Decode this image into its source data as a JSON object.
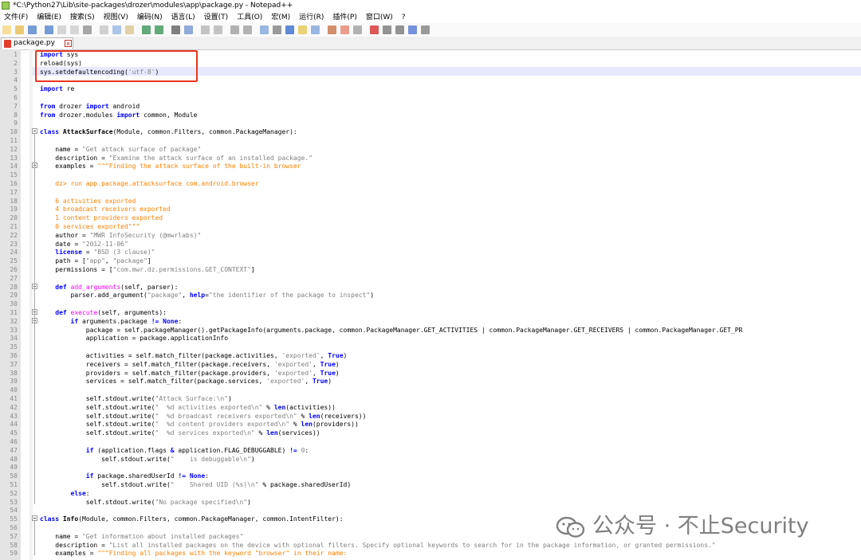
{
  "window": {
    "title": "*C:\\Python27\\Lib\\site-packages\\drozer\\modules\\app\\package.py - Notepad++"
  },
  "menu": [
    "文件(F)",
    "编辑(E)",
    "搜索(S)",
    "视图(V)",
    "编码(N)",
    "语言(L)",
    "设置(T)",
    "工具(O)",
    "宏(M)",
    "运行(R)",
    "插件(P)",
    "窗口(W)",
    "?"
  ],
  "toolbar_icons": [
    "new-icon",
    "open-icon",
    "save-icon",
    "save-all-icon",
    "close-icon",
    "close-all-icon",
    "print-icon",
    "cut-icon",
    "copy-icon",
    "paste-icon",
    "undo-icon",
    "redo-icon",
    "find-icon",
    "replace-icon",
    "zoom-in-icon",
    "zoom-out-icon",
    "sync-v-icon",
    "sync-h-icon",
    "wrap-icon",
    "all-chars-icon",
    "indent-guide-icon",
    "udl-icon",
    "doc-map-icon",
    "func-list-icon",
    "folder-workspace-icon",
    "monitor-icon",
    "record-icon",
    "stop-icon",
    "play-icon",
    "run-multiple-icon",
    "save-macro-icon"
  ],
  "tab": {
    "label": "package.py",
    "close": "x"
  },
  "watermark": {
    "text": "公众号 · 不止Security"
  },
  "colors": {
    "keyword": "#0000ff",
    "string": "#808080",
    "docstring": "#ff8000",
    "funcname": "#ff00ff",
    "highlight": "#e8e8ff",
    "annotation": "#e8361f"
  },
  "lines": [
    [
      [
        "import",
        "k"
      ],
      [
        " sys",
        "n"
      ]
    ],
    [
      [
        "reload(sys)",
        "n"
      ]
    ],
    [
      [
        "sys.setdefaultencoding(",
        "n"
      ],
      [
        "'utf-8'",
        "s"
      ],
      [
        ")",
        "n"
      ]
    ],
    [],
    [
      [
        "import",
        "k"
      ],
      [
        " re",
        "n"
      ]
    ],
    [],
    [
      [
        "from",
        "k"
      ],
      [
        " drozer ",
        "n"
      ],
      [
        "import",
        "k"
      ],
      [
        " android",
        "n"
      ]
    ],
    [
      [
        "from",
        "k"
      ],
      [
        " drozer.modules ",
        "n"
      ],
      [
        "import",
        "k"
      ],
      [
        " common, Module",
        "n"
      ]
    ],
    [],
    [
      [
        "class",
        "k"
      ],
      [
        " ",
        "n"
      ],
      [
        "AttackSurface",
        "c"
      ],
      [
        "(Module, common.Filters, common.PackageManager):",
        "n"
      ]
    ],
    [],
    [
      [
        "    name = ",
        "n"
      ],
      [
        "\"Get attack surface of package\"",
        "s"
      ]
    ],
    [
      [
        "    description = ",
        "n"
      ],
      [
        "\"Examine the attack surface of an installed package.\"",
        "s"
      ]
    ],
    [
      [
        "    examples = ",
        "n"
      ],
      [
        "\"\"\"Finding the attack surface of the built-in browser",
        "d"
      ]
    ],
    [],
    [
      [
        "    dz> run app.package.attacksurface com.android.browser",
        "d"
      ]
    ],
    [],
    [
      [
        "    6 activities exported",
        "d"
      ]
    ],
    [
      [
        "    4 broadcast receivers exported",
        "d"
      ]
    ],
    [
      [
        "    1 content providers exported",
        "d"
      ]
    ],
    [
      [
        "    0 services exported\"\"\"",
        "d"
      ]
    ],
    [
      [
        "    author = ",
        "n"
      ],
      [
        "\"MWR InfoSecurity (@mwrlabs)\"",
        "s"
      ]
    ],
    [
      [
        "    date = ",
        "n"
      ],
      [
        "\"2012-11-06\"",
        "s"
      ]
    ],
    [
      [
        "    ",
        "n"
      ],
      [
        "license",
        "k"
      ],
      [
        " = ",
        "n"
      ],
      [
        "\"BSD (3 clause)\"",
        "s"
      ]
    ],
    [
      [
        "    path = [",
        "n"
      ],
      [
        "\"app\"",
        "s"
      ],
      [
        ", ",
        "n"
      ],
      [
        "\"package\"",
        "s"
      ],
      [
        "]",
        "n"
      ]
    ],
    [
      [
        "    permissions = [",
        "n"
      ],
      [
        "\"com.mwr.dz.permissions.GET_CONTEXT\"",
        "s"
      ],
      [
        "]",
        "n"
      ]
    ],
    [],
    [
      [
        "    ",
        "n"
      ],
      [
        "def",
        "k"
      ],
      [
        " ",
        "n"
      ],
      [
        "add_arguments",
        "f"
      ],
      [
        "(self, parser):",
        "n"
      ]
    ],
    [
      [
        "        parser.add_argument(",
        "n"
      ],
      [
        "\"package\"",
        "s"
      ],
      [
        ", ",
        "n"
      ],
      [
        "help",
        "k"
      ],
      [
        "=",
        "n"
      ],
      [
        "\"the identifier of the package to inspect\"",
        "s"
      ],
      [
        ")",
        "n"
      ]
    ],
    [],
    [
      [
        "    ",
        "n"
      ],
      [
        "def",
        "k"
      ],
      [
        " ",
        "n"
      ],
      [
        "execute",
        "f"
      ],
      [
        "(self, arguments):",
        "n"
      ]
    ],
    [
      [
        "        ",
        "n"
      ],
      [
        "if",
        "k"
      ],
      [
        " arguments.package ",
        "n"
      ],
      [
        "!=",
        "k"
      ],
      [
        " ",
        "n"
      ],
      [
        "None",
        "k"
      ],
      [
        ":",
        "n"
      ]
    ],
    [
      [
        "            package = self.packageManager().getPackageInfo(arguments.package, common.PackageManager.GET_ACTIVITIES | common.PackageManager.GET_RECEIVERS | common.PackageManager.GET_PR",
        "n"
      ]
    ],
    [
      [
        "            application = package.applicationInfo",
        "n"
      ]
    ],
    [],
    [
      [
        "            activities = self.match_filter(package.activities, ",
        "n"
      ],
      [
        "'exported'",
        "s"
      ],
      [
        ", ",
        "n"
      ],
      [
        "True",
        "k"
      ],
      [
        ")",
        "n"
      ]
    ],
    [
      [
        "            receivers = self.match_filter(package.receivers, ",
        "n"
      ],
      [
        "'exported'",
        "s"
      ],
      [
        ", ",
        "n"
      ],
      [
        "True",
        "k"
      ],
      [
        ")",
        "n"
      ]
    ],
    [
      [
        "            providers = self.match_filter(package.providers, ",
        "n"
      ],
      [
        "'exported'",
        "s"
      ],
      [
        ", ",
        "n"
      ],
      [
        "True",
        "k"
      ],
      [
        ")",
        "n"
      ]
    ],
    [
      [
        "            services = self.match_filter(package.services, ",
        "n"
      ],
      [
        "'exported'",
        "s"
      ],
      [
        ", ",
        "n"
      ],
      [
        "True",
        "k"
      ],
      [
        ")",
        "n"
      ]
    ],
    [],
    [
      [
        "            self.stdout.write(",
        "n"
      ],
      [
        "\"Attack Surface:\\n\"",
        "s"
      ],
      [
        ")",
        "n"
      ]
    ],
    [
      [
        "            self.stdout.write(",
        "n"
      ],
      [
        "\"  %d activities exported\\n\"",
        "s"
      ],
      [
        " % ",
        "n"
      ],
      [
        "len",
        "k"
      ],
      [
        "(activities))",
        "n"
      ]
    ],
    [
      [
        "            self.stdout.write(",
        "n"
      ],
      [
        "\"  %d broadcast receivers exported\\n\"",
        "s"
      ],
      [
        " % ",
        "n"
      ],
      [
        "len",
        "k"
      ],
      [
        "(receivers))",
        "n"
      ]
    ],
    [
      [
        "            self.stdout.write(",
        "n"
      ],
      [
        "\"  %d content providers exported\\n\"",
        "s"
      ],
      [
        " % ",
        "n"
      ],
      [
        "len",
        "k"
      ],
      [
        "(providers))",
        "n"
      ]
    ],
    [
      [
        "            self.stdout.write(",
        "n"
      ],
      [
        "\"  %d services exported\\n\"",
        "s"
      ],
      [
        " % ",
        "n"
      ],
      [
        "len",
        "k"
      ],
      [
        "(services))",
        "n"
      ]
    ],
    [],
    [
      [
        "            ",
        "n"
      ],
      [
        "if",
        "k"
      ],
      [
        " (application.flags ",
        "n"
      ],
      [
        "&",
        "k"
      ],
      [
        " application.FLAG_DEBUGGABLE) ",
        "n"
      ],
      [
        "!=",
        "k"
      ],
      [
        " ",
        "n"
      ],
      [
        "0",
        "s"
      ],
      [
        ":",
        "n"
      ]
    ],
    [
      [
        "                self.stdout.write(",
        "n"
      ],
      [
        "\"    is debuggable\\n\"",
        "s"
      ],
      [
        ")",
        "n"
      ]
    ],
    [],
    [
      [
        "            ",
        "n"
      ],
      [
        "if",
        "k"
      ],
      [
        " package.sharedUserId ",
        "n"
      ],
      [
        "!=",
        "k"
      ],
      [
        " ",
        "n"
      ],
      [
        "None",
        "k"
      ],
      [
        ":",
        "n"
      ]
    ],
    [
      [
        "                self.stdout.write(",
        "n"
      ],
      [
        "\"    Shared UID (%s)\\n\"",
        "s"
      ],
      [
        " % package.sharedUserId)",
        "n"
      ]
    ],
    [
      [
        "        ",
        "n"
      ],
      [
        "else",
        "k"
      ],
      [
        ":",
        "n"
      ]
    ],
    [
      [
        "            self.stdout.write(",
        "n"
      ],
      [
        "\"No package specified\\n\"",
        "s"
      ],
      [
        ")",
        "n"
      ]
    ],
    [],
    [
      [
        "class",
        "k"
      ],
      [
        " ",
        "n"
      ],
      [
        "Info",
        "c"
      ],
      [
        "(Module, common.Filters, common.PackageManager, common.IntentFilter):",
        "n"
      ]
    ],
    [],
    [
      [
        "    name = ",
        "n"
      ],
      [
        "\"Get information about installed packages\"",
        "s"
      ]
    ],
    [
      [
        "    description = ",
        "n"
      ],
      [
        "\"List all installed packages on the device with optional filters. Specify optional keywords to search for in the package information, or granted permissions.\"",
        "s"
      ]
    ],
    [
      [
        "    examples = ",
        "n"
      ],
      [
        "\"\"\"Finding all packages with the keyword \"browser\" in their name:",
        "d"
      ]
    ]
  ]
}
